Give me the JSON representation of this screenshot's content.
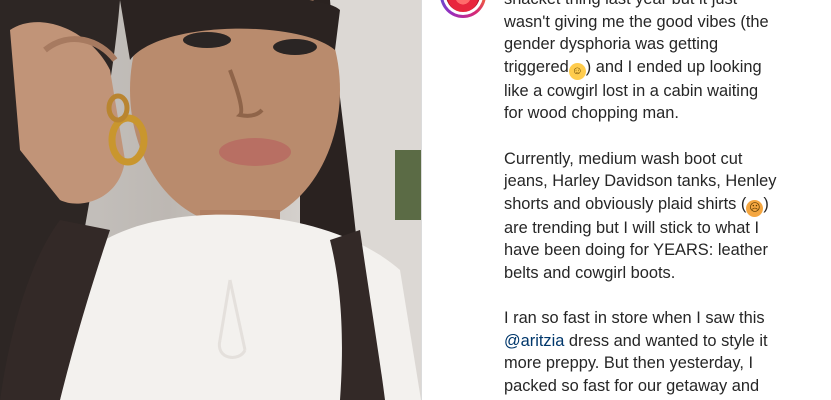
{
  "post": {
    "avatar_icon": "profile-avatar-icon",
    "caption_lines": {
      "l1": "shacket thing last year but it just",
      "l2": "wasn't giving me the good vibes (the",
      "l3": "gender dysphoria was getting",
      "l4_pre": "triggered",
      "l4_post": ") and I ended up looking",
      "l5": "like a cowgirl lost in a cabin waiting",
      "l6": "for wood chopping man.",
      "l7": "Currently, medium wash boot cut",
      "l8": "jeans, Harley Davidson tanks, Henley",
      "l9_pre": "shorts and obviously plaid shirts (",
      "l9_post": ")",
      "l10": "are trending but I will stick to what I",
      "l11": "have been doing for YEARS: leather",
      "l12": "belts and cowgirl boots.",
      "l13": "I ran so fast in store when I saw this",
      "l14_mention": "@aritzia",
      "l14_post": " dress and wanted to style it",
      "l15": "more preppy. But then yesterday, I",
      "l16": "packed so fast for our getaway and"
    },
    "emojis": {
      "sweat_smile": "sweat-smile-emoji-icon",
      "tired": "tired-face-emoji-icon"
    }
  }
}
